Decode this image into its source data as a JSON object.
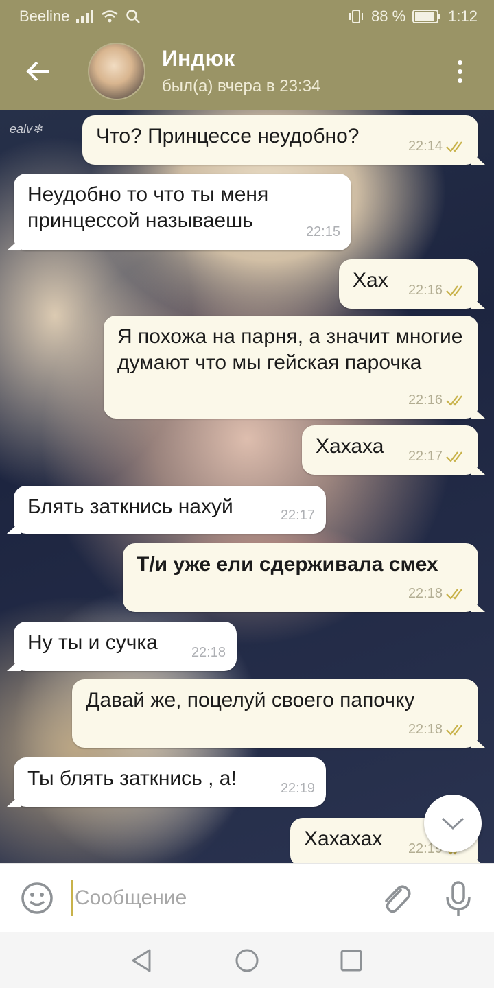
{
  "status_bar": {
    "carrier": "Beeline",
    "battery": "88 %",
    "time": "1:12",
    "icons": [
      "signal-icon",
      "wifi-icon",
      "search-icon",
      "vibrate-icon",
      "battery-icon"
    ]
  },
  "header": {
    "title": "Индюк",
    "subtitle": "был(а) вчера в 23:34"
  },
  "wallpaper_watermark": "ealv❄",
  "messages": [
    {
      "dir": "out",
      "text": "Что? Принцессе неудобно?",
      "time": "22:14"
    },
    {
      "dir": "in",
      "text": "Неудобно то что ты меня принцессой называешь",
      "time": "22:15"
    },
    {
      "dir": "out",
      "text": "Хах",
      "time": "22:16"
    },
    {
      "dir": "out",
      "text": "Я похожа на парня, а значит многие думают что мы гейская парочка",
      "time": "22:16"
    },
    {
      "dir": "out",
      "text": "Хахаха",
      "time": "22:17"
    },
    {
      "dir": "in",
      "text": "Блять заткнись нахуй",
      "time": "22:17"
    },
    {
      "dir": "out",
      "text": "Т/и уже ели сдерживала смех",
      "time": "22:18"
    },
    {
      "dir": "in",
      "text": "Ну ты и сучка",
      "time": "22:18"
    },
    {
      "dir": "out",
      "text": "Давай же, поцелуй своего папочку",
      "time": "22:18"
    },
    {
      "dir": "in",
      "text": "Ты блять заткнись , а!",
      "time": "22:19"
    },
    {
      "dir": "out",
      "text": "Хахахах",
      "time": "22:19"
    }
  ],
  "composer": {
    "placeholder": "Сообщение"
  },
  "colors": {
    "header": "#9a9466",
    "out_bubble": "#fbf8e9",
    "in_bubble": "#ffffff",
    "check": "#c8b24a"
  }
}
